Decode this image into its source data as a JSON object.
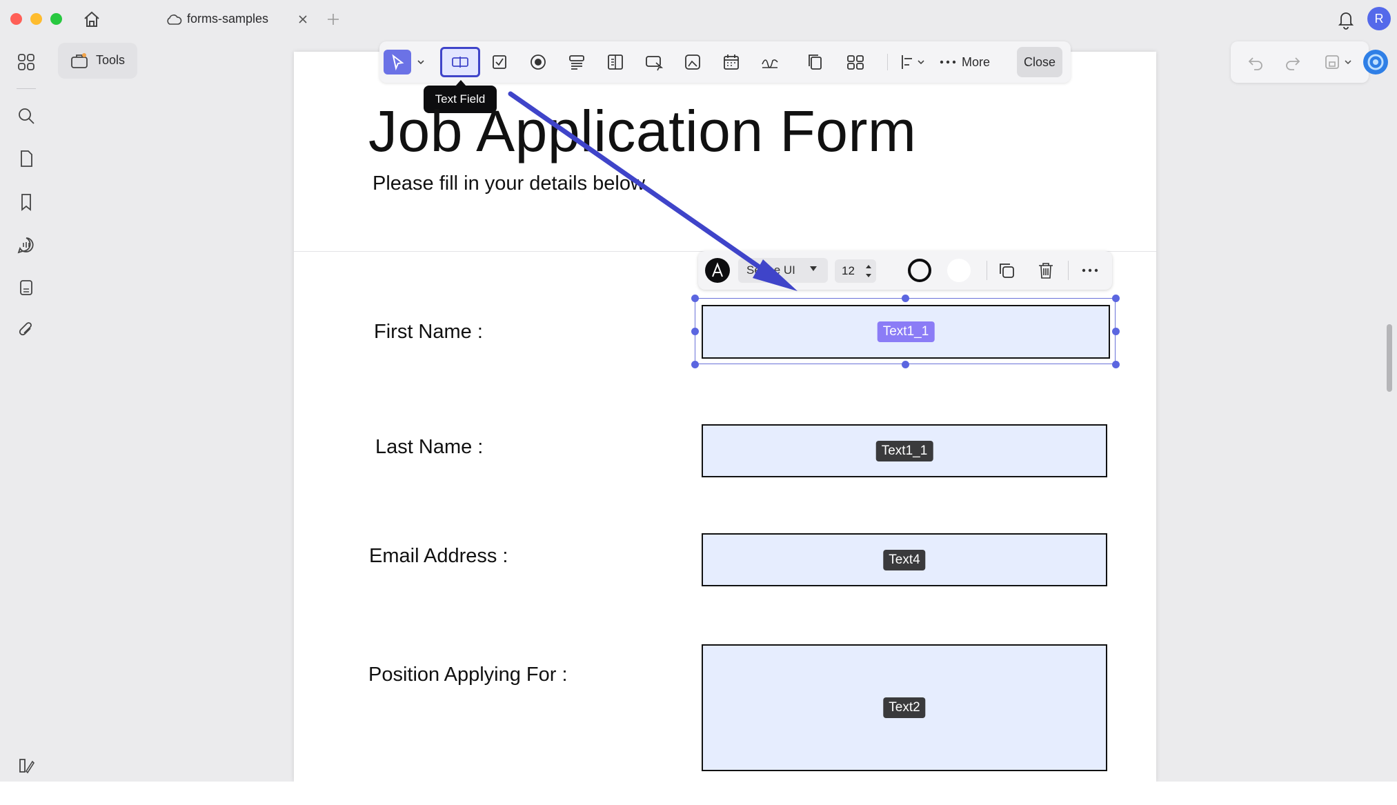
{
  "window": {
    "tab_title": "forms-samples",
    "avatar_letter": "R"
  },
  "left_toolbar": {
    "tools_label": "Tools"
  },
  "toolbar": {
    "more_label": "More",
    "close_label": "Close",
    "tooltip": "Text Field"
  },
  "properties": {
    "font_name": "Segoe UI",
    "font_size": "12"
  },
  "document": {
    "title": "Job Application Form",
    "subtitle": "Please fill in your details below.",
    "fields": [
      {
        "label": "First Name :",
        "tag": "Text1_1"
      },
      {
        "label": "Last Name :",
        "tag": "Text1_1"
      },
      {
        "label": "Email Address :",
        "tag": "Text4"
      },
      {
        "label": "Position Applying For :",
        "tag": "Text2"
      }
    ]
  },
  "colors": {
    "accent": "#6b72e6",
    "arrow": "#3f44c9",
    "field_fill": "#e6edfe",
    "selected_tag": "#8b7cf6"
  }
}
